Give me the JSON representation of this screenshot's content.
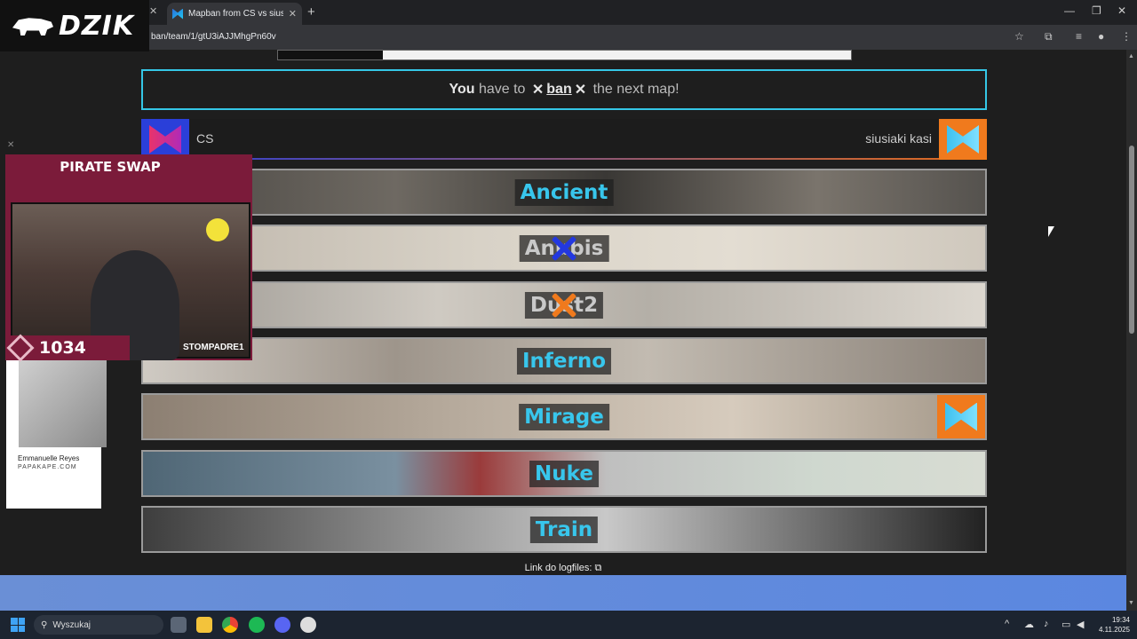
{
  "browser": {
    "tab_title": "Mapban from CS vs siusiaki kasi",
    "url": "ban/team/1/gtU3iAJJMhgPn60v"
  },
  "overlay": {
    "brand": "DZIK",
    "sponsor": "PIRATE SWAP",
    "counter": "1034",
    "tiktok": "STOMPADRE1",
    "ad_name": "Emmanuelle Reyes",
    "ad_site": "PAPAKAPE.COM"
  },
  "notice": {
    "you": "You",
    "have_to": " have to ",
    "x_mark": "✕",
    "action": "ban",
    "rest": " the next map!"
  },
  "teams": {
    "left": "CS",
    "right": "siusiaki kasi"
  },
  "maps": [
    {
      "name": "Ancient",
      "status": "available"
    },
    {
      "name": "Anubis",
      "status": "banned",
      "by": "left"
    },
    {
      "name": "Dust2",
      "status": "banned",
      "by": "right"
    },
    {
      "name": "Inferno",
      "status": "available"
    },
    {
      "name": "Mirage",
      "status": "picked",
      "by": "right"
    },
    {
      "name": "Nuke",
      "status": "available"
    },
    {
      "name": "Train",
      "status": "available"
    }
  ],
  "footer": {
    "logfiles": "Link do logfiles:"
  },
  "taskbar": {
    "search_placeholder": "Wyszukaj",
    "time": "19:34",
    "date": "4.11.2025"
  },
  "colors": {
    "accent": "#35c7e6",
    "team_left": "#2a3fd9",
    "team_right": "#f07a1d"
  }
}
